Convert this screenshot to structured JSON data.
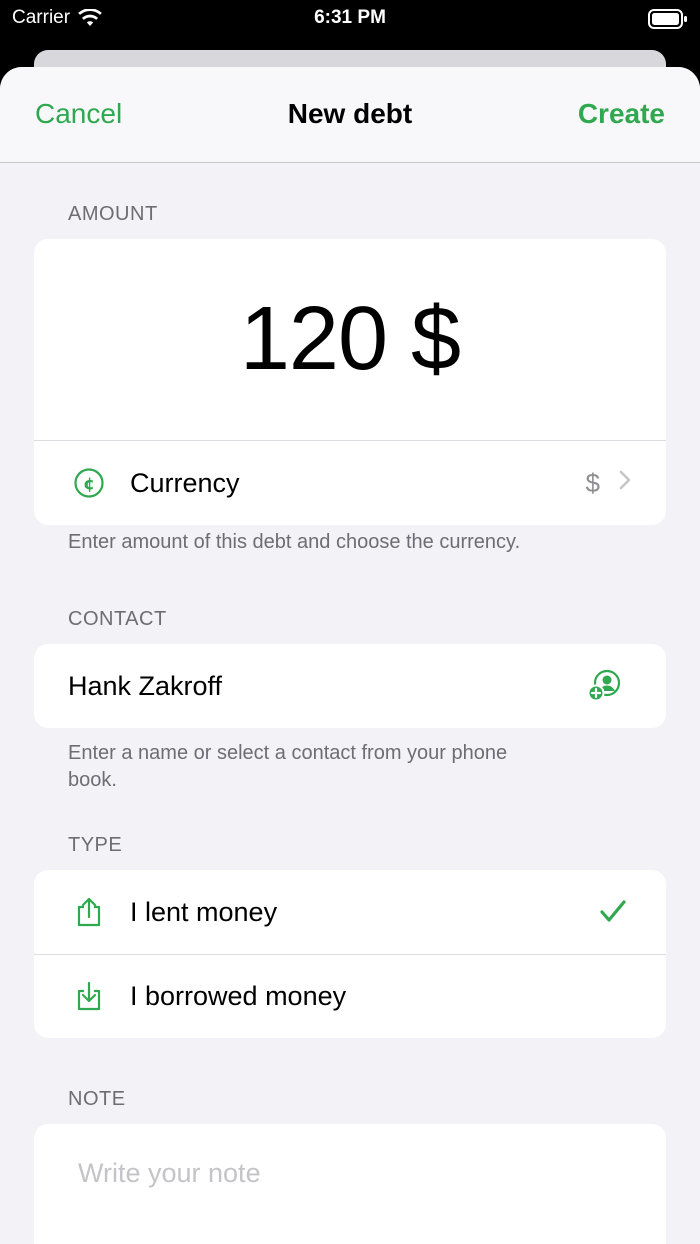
{
  "status_bar": {
    "carrier": "Carrier",
    "time": "6:31 PM"
  },
  "nav": {
    "cancel_label": "Cancel",
    "title": "New debt",
    "create_label": "Create"
  },
  "amount_section": {
    "header": "AMOUNT",
    "amount": "120 $",
    "currency_label": "Currency",
    "currency_value": "$",
    "footer": "Enter amount of this debt and choose the currency."
  },
  "contact_section": {
    "header": "CONTACT",
    "name": "Hank Zakroff",
    "footer": "Enter a name or select a contact from your phone book."
  },
  "type_section": {
    "header": "TYPE",
    "options": [
      {
        "label": "I lent money",
        "selected": true
      },
      {
        "label": "I borrowed money",
        "selected": false
      }
    ]
  },
  "note_section": {
    "header": "NOTE",
    "placeholder": "Write your note"
  },
  "colors": {
    "accent": "#2fa84f",
    "background": "#f2f2f7",
    "secondary_text": "#6d6d72"
  }
}
